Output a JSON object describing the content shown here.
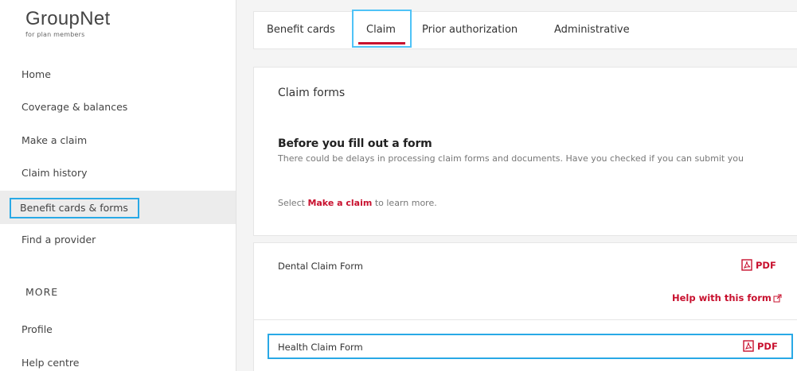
{
  "logo": {
    "name": "GroupNet",
    "tagline": "for plan members"
  },
  "sidebar": {
    "items": [
      {
        "label": "Home"
      },
      {
        "label": "Coverage & balances"
      },
      {
        "label": "Make a claim"
      },
      {
        "label": "Claim history"
      },
      {
        "label": "Benefit cards & forms",
        "active": true
      },
      {
        "label": "Find a provider"
      }
    ],
    "more_heading": "MORE",
    "more_items": [
      {
        "label": "Profile"
      },
      {
        "label": "Help centre"
      }
    ]
  },
  "tabs": [
    {
      "label": "Benefit cards"
    },
    {
      "label": "Claim",
      "active": true
    },
    {
      "label": "Prior authorization"
    },
    {
      "label": "Administrative"
    }
  ],
  "claim_forms": {
    "title": "Claim forms",
    "before_title": "Before you fill out a form",
    "before_body": "There could be delays in processing claim forms and documents. Have you checked if you can submit you",
    "select_prefix": "Select ",
    "select_link": "Make a claim",
    "select_suffix": " to learn more."
  },
  "forms": [
    {
      "name": "Dental Claim Form",
      "pdf_label": "PDF",
      "help_label": "Help with this form"
    },
    {
      "name": "Health Claim Form",
      "pdf_label": "PDF"
    }
  ],
  "colors": {
    "accent": "#c8102e",
    "highlight": "#29a9e6"
  },
  "icons": {
    "pdf": "pdf-icon",
    "external": "external-link-icon"
  }
}
